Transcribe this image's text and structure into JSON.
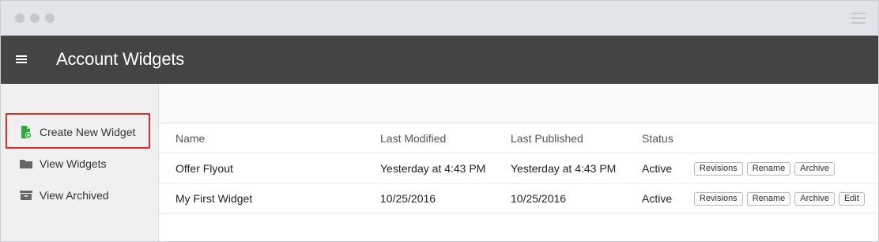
{
  "header": {
    "title": "Account Widgets"
  },
  "sidebar": {
    "items": [
      {
        "label": "Create New Widget",
        "icon": "file-plus-icon"
      },
      {
        "label": "View Widgets",
        "icon": "folder-icon"
      },
      {
        "label": "View Archived",
        "icon": "archive-box-icon"
      }
    ],
    "highlight_color": "#e12a2a",
    "create_icon_color": "#2eaa3c"
  },
  "table": {
    "columns": [
      "Name",
      "Last Modified",
      "Last Published",
      "Status"
    ],
    "rows": [
      {
        "name": "Offer Flyout",
        "last_modified": "Yesterday at 4:43 PM",
        "last_published": "Yesterday at 4:43 PM",
        "status": "Active",
        "actions": [
          "Revisions",
          "Rename",
          "Archive"
        ]
      },
      {
        "name": "My First Widget",
        "last_modified": "10/25/2016",
        "last_published": "10/25/2016",
        "status": "Active",
        "actions": [
          "Revisions",
          "Rename",
          "Archive",
          "Edit"
        ]
      }
    ]
  },
  "colors": {
    "header_bg": "#444444",
    "chrome_bg": "#e1e5e9",
    "sidebar_bg": "#f0f0f0"
  }
}
